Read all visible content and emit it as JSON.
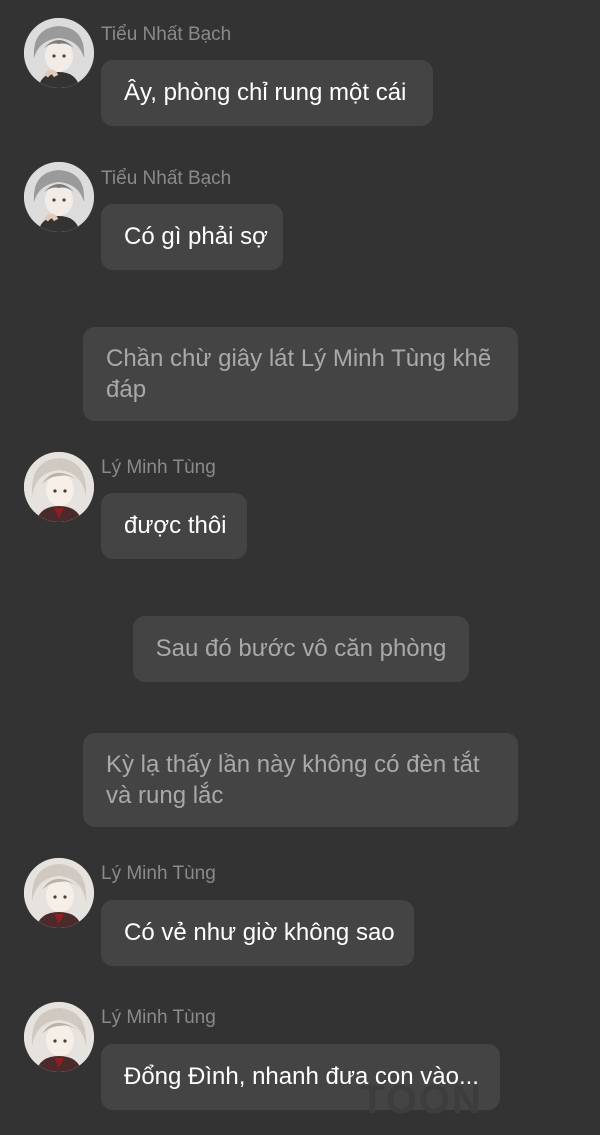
{
  "messages": [
    {
      "sender": "Tiểu Nhất Bạch",
      "text": "Ây, phòng chỉ rung một cái"
    },
    {
      "sender": "Tiểu Nhất Bạch",
      "text": "Có gì phải sợ"
    },
    {
      "narration": "Chần chừ giây lát Lý Minh Tùng khẽ đáp"
    },
    {
      "sender": "Lý Minh Tùng",
      "text": "được thôi"
    },
    {
      "narration": "Sau đó bước vô căn phòng"
    },
    {
      "narration": "Kỳ lạ thấy lần này không có đèn tắt và rung lắc"
    },
    {
      "sender": "Lý Minh Tùng",
      "text": "Có vẻ như giờ không sao"
    },
    {
      "sender": "Lý Minh Tùng",
      "text": "Đổng Đình, nhanh đưa con vào..."
    }
  ],
  "watermark": "TOON"
}
